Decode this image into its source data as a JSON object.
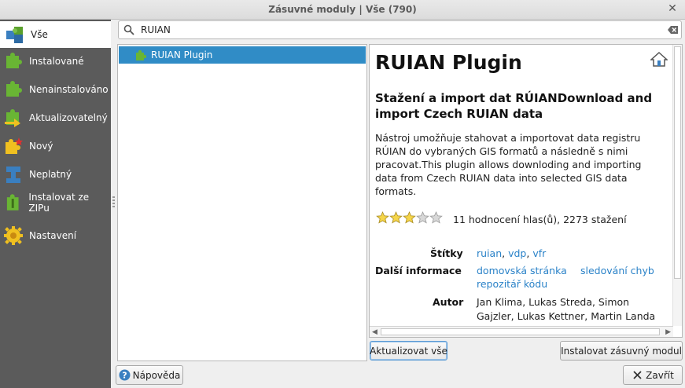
{
  "window": {
    "title": "Zásuvné moduly | Vše (790)"
  },
  "sidebar": {
    "items": [
      {
        "label": "Vše",
        "icon": "all-plugins-icon",
        "active": true
      },
      {
        "label": "Instalované",
        "icon": "installed-icon"
      },
      {
        "label": "Nenainstalováno",
        "icon": "not-installed-icon"
      },
      {
        "label": "Aktualizovatelný",
        "icon": "upgradeable-icon"
      },
      {
        "label": "Nový",
        "icon": "new-icon"
      },
      {
        "label": "Neplatný",
        "icon": "invalid-icon"
      },
      {
        "label": "Instalovat ze ZIPu",
        "icon": "zip-install-icon"
      },
      {
        "label": "Nastavení",
        "icon": "settings-gear-icon"
      }
    ]
  },
  "search": {
    "value": "RUIAN"
  },
  "plugin_list": {
    "items": [
      {
        "label": "RUIAN Plugin",
        "selected": true
      }
    ]
  },
  "details": {
    "title": "RUIAN Plugin",
    "subtitle": "Stažení a import dat RÚIANDownload and import Czech RUIAN data",
    "description": "Nástroj umožňuje stahovat a importovat data registru RÚIAN do vybraných GIS formatů a následně s nimi pracovat.This plugin allows downloding and importing data from Czech RUIAN data into selected GIS data formats.",
    "rating_stars": 3,
    "rating_max": 5,
    "rating_text": "11 hodnocení hlas(ů), 2273 stažení",
    "tags_label": "Štítky",
    "tags": [
      "ruian",
      "vdp",
      "vfr"
    ],
    "more_info_label": "Další informace",
    "links": [
      "domovská stránka",
      "sledování chyb",
      "repozitář kódu"
    ],
    "author_label": "Autor",
    "authors_line1": "Jan Klima, Lukas Streda, Simon",
    "authors_line2": "Gajzler, Lukas Kettner, Martin Landa"
  },
  "buttons": {
    "upgrade_all": "Aktualizovat vše",
    "install": "Instalovat zásuvný modul",
    "help": "Nápověda",
    "close": "Zavřít"
  },
  "colors": {
    "sidebar_bg": "#5b5b5b",
    "selection": "#308cc6",
    "link": "#2a82c8"
  }
}
